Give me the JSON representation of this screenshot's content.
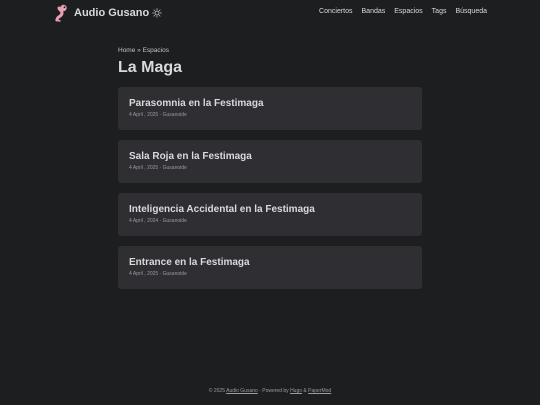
{
  "site": {
    "title": "Audio Gusano",
    "logo_icon": "worm-icon",
    "theme_icon": "sun-icon"
  },
  "nav": {
    "items": [
      {
        "label": "Conciertos"
      },
      {
        "label": "Bandas"
      },
      {
        "label": "Espacios"
      },
      {
        "label": "Tags"
      },
      {
        "label": "Búsqueda"
      }
    ]
  },
  "breadcrumb": {
    "home": "Home",
    "separator": "»",
    "current": "Espacios"
  },
  "page": {
    "title": "La Maga"
  },
  "posts": [
    {
      "title": "Parasomnia en la Festimaga",
      "meta": "4 April , 2025 · Gusanoide"
    },
    {
      "title": "Sala Roja en la Festimaga",
      "meta": "4 April , 2025 · Gusanoide"
    },
    {
      "title": "Inteligencia Accidental en la Festimaga",
      "meta": "4 April , 2024 · Gusanoide"
    },
    {
      "title": "Entrance en la Festimaga",
      "meta": "4 April , 2025 · Gusanoide"
    }
  ],
  "footer": {
    "copyright": "© 2025",
    "site_link": "Audio Gusano",
    "powered_by": "· Powered by",
    "hugo": "Hugo",
    "amp": "&",
    "papermod": "PaperMod"
  },
  "colors": {
    "background": "#1d1e20",
    "card": "#2e2e33",
    "text": "#dadadb",
    "secondary": "#9b9c9d",
    "worm": "#e8a0b4"
  }
}
